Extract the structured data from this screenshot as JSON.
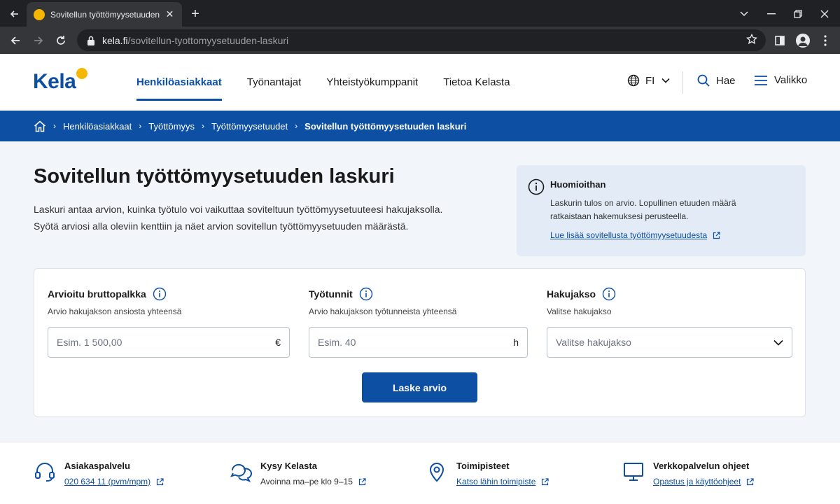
{
  "browser": {
    "tab_title": "Sovitellun työttömyysetuuden laskuri",
    "favicon_letter": "",
    "url_domain": "kela.fi",
    "url_path": "/sovitellun-tyottomyysetuuden-laskuri"
  },
  "header": {
    "logo_text": "Kela",
    "nav": [
      {
        "label": "Henkilöasiakkaat"
      },
      {
        "label": "Työnantajat"
      },
      {
        "label": "Yhteistyökumppanit"
      },
      {
        "label": "Tietoa Kelasta"
      }
    ],
    "lang": "FI",
    "search_label": "Hae",
    "menu_label": "Valikko"
  },
  "breadcrumb": [
    {
      "label": "Henkilöasiakkaat"
    },
    {
      "label": "Työttömyys"
    },
    {
      "label": "Työttömyysetuudet"
    },
    {
      "label": "Sovitellun työttömyysetuuden laskuri"
    }
  ],
  "main": {
    "title": "Sovitellun työttömyysetuuden laskuri",
    "intro_line1": "Laskuri antaa arvion, kuinka työtulo voi vaikuttaa soviteltuun työttömyysetuuteesi hakujaksolla.",
    "intro_line2": "Syötä arviosi alla oleviin kenttiin ja näet arvion sovitellun työttömyysetuuden määrästä."
  },
  "notice": {
    "title": "Huomioithan",
    "line1": "Laskurin tulos on arvio. Lopullinen etuuden määrä",
    "line2": "ratkaistaan hakemuksesi perusteella.",
    "link": "Lue lisää sovitellusta työttömyysetuudesta"
  },
  "form": {
    "salary": {
      "label": "Arvioitu bruttopalkka",
      "hint": "Arvio hakujakson ansiosta yhteensä",
      "value": "",
      "placeholder": "Esim. 1 500,00",
      "unit": "€"
    },
    "hours": {
      "label": "Työtunnit",
      "hint": "Arvio hakujakson työtunneista yhteensä",
      "value": "",
      "placeholder": "Esim. 40",
      "unit": "h"
    },
    "period": {
      "label": "Hakujakso",
      "hint": "Valitse hakujakso",
      "selected": "Valitse hakujakso"
    },
    "submit_label": "Laske arvio"
  },
  "footer": [
    {
      "title": "Asiakaspalvelu",
      "sub": "020 634 11 (pvm/mpm)"
    },
    {
      "title": "Kysy Kelasta",
      "sub": "Avoinna ma–pe klo 9–15"
    },
    {
      "title": "Toimipisteet",
      "sub": "Katso lähin toimipiste"
    },
    {
      "title": "Verkkopalvelun ohjeet",
      "sub": "Opastus ja käyttöohjeet"
    }
  ],
  "colors": {
    "brand_blue": "#0d4fa3",
    "brand_yellow": "#f5b800",
    "notice_bg": "#e3ebf6"
  }
}
